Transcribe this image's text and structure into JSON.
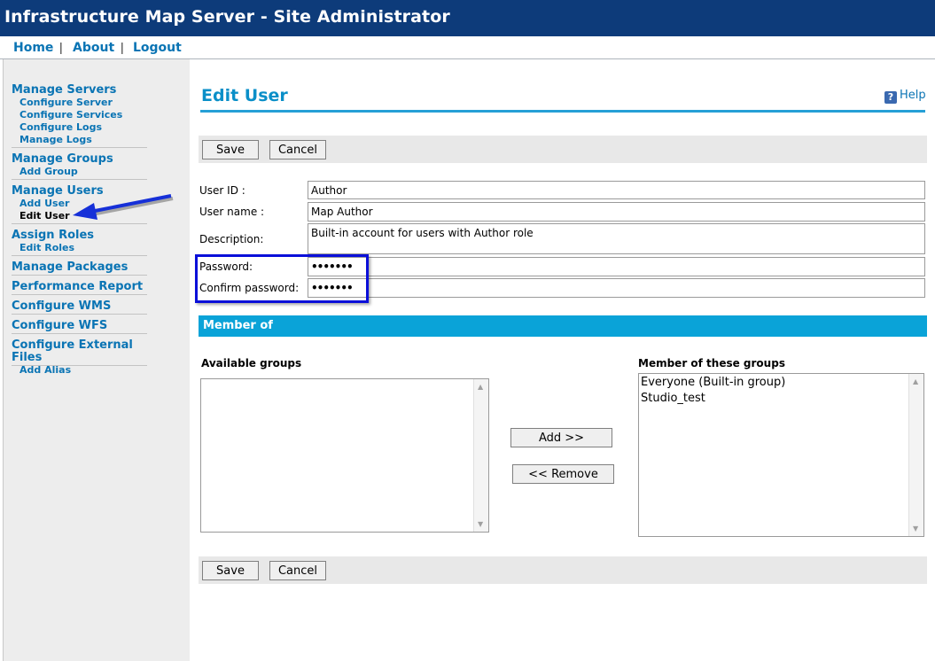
{
  "app": {
    "title": "Infrastructure Map Server - Site Administrator"
  },
  "topnav": {
    "home": "Home",
    "about": "About",
    "logout": "Logout",
    "sep": "|"
  },
  "sidebar": {
    "manage_servers": "Manage Servers",
    "configure_server": "Configure Server",
    "configure_services": "Configure Services",
    "configure_logs": "Configure Logs",
    "manage_logs": "Manage Logs",
    "manage_groups": "Manage Groups",
    "add_group": "Add Group",
    "manage_users": "Manage Users",
    "add_user": "Add User",
    "edit_user": "Edit User",
    "assign_roles": "Assign Roles",
    "edit_roles": "Edit Roles",
    "manage_packages": "Manage Packages",
    "performance_report": "Performance Report",
    "configure_wms": "Configure WMS",
    "configure_wfs": "Configure WFS",
    "configure_external_files": "Configure External Files",
    "add_alias": "Add Alias"
  },
  "page": {
    "title": "Edit User",
    "help": "Help",
    "help_glyph": "?"
  },
  "buttons": {
    "save": "Save",
    "cancel": "Cancel",
    "add": "Add >>",
    "remove": "<< Remove"
  },
  "form": {
    "user_id_label": "User ID :",
    "user_id_value": "Author",
    "user_name_label": "User name :",
    "user_name_value": "Map Author",
    "description_label": "Description:",
    "description_value": "Built-in account for users with Author role",
    "password_label": "Password:",
    "password_value": "•••••••",
    "confirm_password_label": "Confirm password:",
    "confirm_password_value": "•••••••"
  },
  "member_of": {
    "section_title": "Member of",
    "available_label": "Available groups",
    "member_label": "Member of these groups",
    "available_groups": [],
    "member_groups": [
      "Everyone (Built-in group)",
      "Studio_test"
    ]
  },
  "colors": {
    "title_bar": "#0d3b7a",
    "accent": "#0aa3d8",
    "link": "#0a74b4",
    "highlight_box": "#0b0fd9",
    "arrow": "#1630d8"
  }
}
